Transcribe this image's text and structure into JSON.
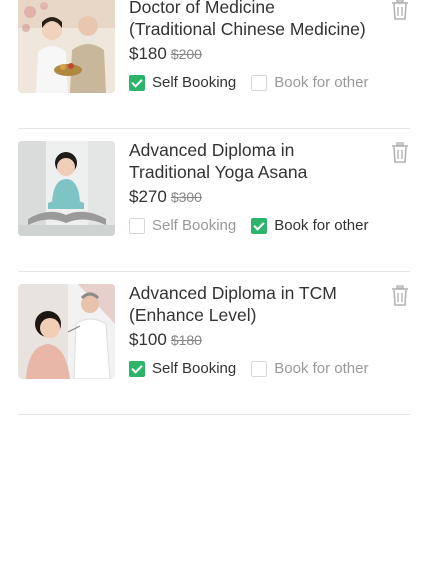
{
  "cart": {
    "items": [
      {
        "title_line1": "Doctor of Medicine",
        "title_line2": "(Traditional Chinese Medicine)",
        "price": "$180",
        "old_price": "$200",
        "options": [
          {
            "label": "Self Booking",
            "checked": true
          },
          {
            "label": "Book for other",
            "checked": false
          }
        ],
        "image_icon": "tcm-doctors-photo"
      },
      {
        "title_line1": "Advanced Diploma in",
        "title_line2": "Traditional Yoga Asana",
        "price": "$270",
        "old_price": "$300",
        "options": [
          {
            "label": "Self Booking",
            "checked": false
          },
          {
            "label": "Book for other",
            "checked": true
          }
        ],
        "image_icon": "yoga-photo"
      },
      {
        "title_line1": "Advanced Diploma in TCM",
        "title_line2": "(Enhance Level)",
        "price": "$100",
        "old_price": "$180",
        "options": [
          {
            "label": "Self Booking",
            "checked": true
          },
          {
            "label": "Book for other",
            "checked": false
          }
        ],
        "image_icon": "acupuncture-photo"
      }
    ],
    "delete_icon": "trash-icon",
    "check_color": "#2db36a"
  }
}
